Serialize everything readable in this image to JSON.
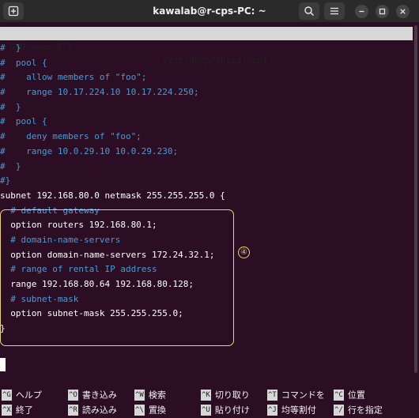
{
  "window": {
    "title": "kawalab@r-cps-PC: ~"
  },
  "nano": {
    "version": "GNU nano 6.2",
    "filename": "/etc/dhcp/dhcpd.conf"
  },
  "lines": [
    {
      "text": "#  }",
      "kind": "comment"
    },
    {
      "text": "#  pool {",
      "kind": "comment"
    },
    {
      "text": "#    allow members of \"foo\";",
      "kind": "comment"
    },
    {
      "text": "#    range 10.17.224.10 10.17.224.250;",
      "kind": "comment"
    },
    {
      "text": "#  }",
      "kind": "comment"
    },
    {
      "text": "#  pool {",
      "kind": "comment"
    },
    {
      "text": "#    deny members of \"foo\";",
      "kind": "comment"
    },
    {
      "text": "#    range 10.0.29.10 10.0.29.230;",
      "kind": "comment"
    },
    {
      "text": "#  }",
      "kind": "comment"
    },
    {
      "text": "#}",
      "kind": "comment"
    },
    {
      "text": "subnet 192.168.80.0 netmask 255.255.255.0 {",
      "kind": "text"
    },
    {
      "text": "  # default gateway",
      "kind": "comment"
    },
    {
      "text": "  option routers 192.168.80.1;",
      "kind": "text"
    },
    {
      "text": "  # domain-name-servers",
      "kind": "comment"
    },
    {
      "text": "  option domain-name-servers 172.24.32.1;",
      "kind": "text"
    },
    {
      "text": "  # range of rental IP address",
      "kind": "comment"
    },
    {
      "text": "  range 192.168.80.64 192.168.80.128;",
      "kind": "text"
    },
    {
      "text": "  # subnet-mask",
      "kind": "comment"
    },
    {
      "text": "  option subnet-mask 255.255.255.0;",
      "kind": "text"
    },
    {
      "text": "}",
      "kind": "text"
    }
  ],
  "annotation": {
    "badge": "④"
  },
  "shortcuts": [
    {
      "key": "^G",
      "label": "ヘルプ"
    },
    {
      "key": "^O",
      "label": "書き込み"
    },
    {
      "key": "^W",
      "label": "検索"
    },
    {
      "key": "^K",
      "label": "切り取り"
    },
    {
      "key": "^T",
      "label": "コマンドを"
    },
    {
      "key": "^C",
      "label": "位置"
    },
    {
      "key": "^X",
      "label": "終了"
    },
    {
      "key": "^R",
      "label": "読み込み"
    },
    {
      "key": "^\\",
      "label": "置換"
    },
    {
      "key": "^U",
      "label": "貼り付け"
    },
    {
      "key": "^J",
      "label": "均等割付"
    },
    {
      "key": "^/",
      "label": "行を指定"
    }
  ],
  "icons": {
    "new_tab": "new-tab-icon",
    "search": "search-icon",
    "menu": "hamburger-menu-icon",
    "minimize": "minimize-icon",
    "maximize": "maximize-icon",
    "close": "close-icon"
  },
  "colors": {
    "terminal_bg": "#2c0e24",
    "comment": "#4a9bd1",
    "highlight_box": "#e9d36d"
  }
}
